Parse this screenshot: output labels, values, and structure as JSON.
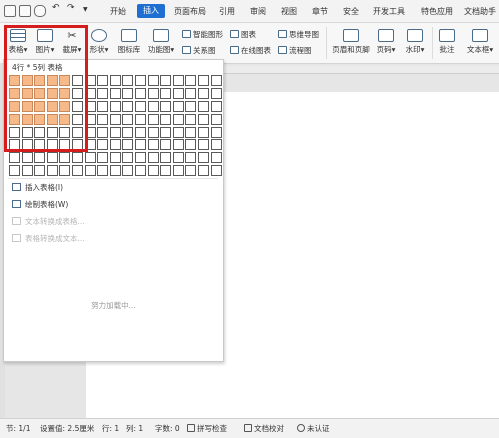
{
  "menubar": {
    "tabs": [
      "开始",
      "插入",
      "页面布局",
      "引用",
      "审阅",
      "视图",
      "章节",
      "安全",
      "开发工具",
      "特色应用",
      "文档助手"
    ],
    "active_tab": "插入"
  },
  "ribbon": {
    "table_btn": "表格",
    "picture_btn": "图片",
    "screenshot_btn": "截屏",
    "shape_btn": "形状",
    "gallery_btn": "图标库",
    "function_btn": "功能图",
    "smartart": "智能图形",
    "chart": "图表",
    "mindmap": "思维导图",
    "relation": "关系图",
    "online_chart": "在线图表",
    "flowchart": "流程图",
    "header_footer": "页眉和页脚",
    "page_number": "页码",
    "watermark": "水印",
    "comment": "批注",
    "textbox": "文本框"
  },
  "dropdown": {
    "grid_caption": "4行 * 5列 表格",
    "grid_rows": 8,
    "grid_cols": 17,
    "selected_rows": 4,
    "selected_cols": 5,
    "menu_items": {
      "insert_table": "插入表格(I)",
      "draw_table": "绘制表格(W)",
      "text_to_table": "文本转换成表格...",
      "table_to_text": "表格转换成文本..."
    },
    "loading": "努力加载中..."
  },
  "statusbar": {
    "section": "节: 1/1",
    "setting": "设置值: 2.5厘米",
    "row": "行: 1",
    "col": "列: 1",
    "words": "字数: 0",
    "spellcheck": "拼写检查",
    "doc_check": "文档校对",
    "unauth": "未认证"
  },
  "colors": {
    "accent": "#1f6fd0",
    "selection": "#f6b98a",
    "highlight": "#d51d1d"
  }
}
